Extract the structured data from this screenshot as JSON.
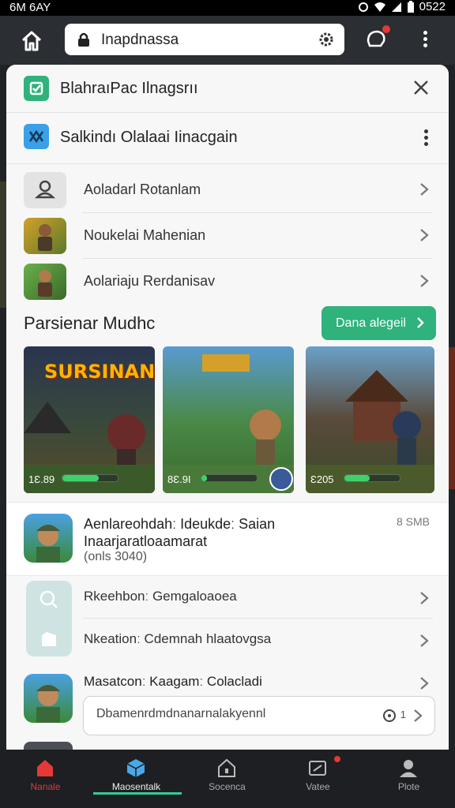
{
  "status": {
    "left": "6M 6AY",
    "time": "0522"
  },
  "browser": {
    "url": "Inapdnassa"
  },
  "sheet": {
    "title": "BlahraıPac Ilnagsrıı",
    "subtitle": "Salkindı Olalaai Iinacgain",
    "list": [
      {
        "label": "Aoladarl Rotanlam"
      },
      {
        "label": "Noukelai Mahenian"
      },
      {
        "label": "Aolariaju Rerdanisav"
      }
    ],
    "section_title": "Parsienar Mudhc",
    "download_button": "Dana alegeil",
    "screenshots": [
      {
        "title": "SURSINANN",
        "caption": "1Ɛ.89",
        "progress": 0.65
      },
      {
        "title": "",
        "caption": "8Ɛ.9I",
        "progress": 0.1
      },
      {
        "title": "",
        "caption": "Ɛ205",
        "progress": 0.45
      }
    ],
    "card": {
      "title": "Aenlareohdahː Ideukdeː Saian Inaarjaratloaamarat",
      "meta": "(onls 3040)",
      "size": "8 SMB"
    },
    "options": [
      {
        "label": "Rkeehbonː Gemgaloaoea"
      },
      {
        "label": "Nkeationː Cdemnah hlaatovgsa"
      }
    ],
    "option3": {
      "label": "Masatconː Kaagamː Colacladi"
    },
    "search": {
      "value": "Dbamenrdmdnanarnalakyennl",
      "counter": "1"
    }
  },
  "nav": [
    {
      "label": "Nanale"
    },
    {
      "label": "Maosentalk"
    },
    {
      "label": "Socenca"
    },
    {
      "label": "Vatee"
    },
    {
      "label": "Plote"
    }
  ],
  "colors": {
    "accent": "#2fb27c",
    "alert": "#e53935",
    "nav_underline": "#2fcf94"
  }
}
